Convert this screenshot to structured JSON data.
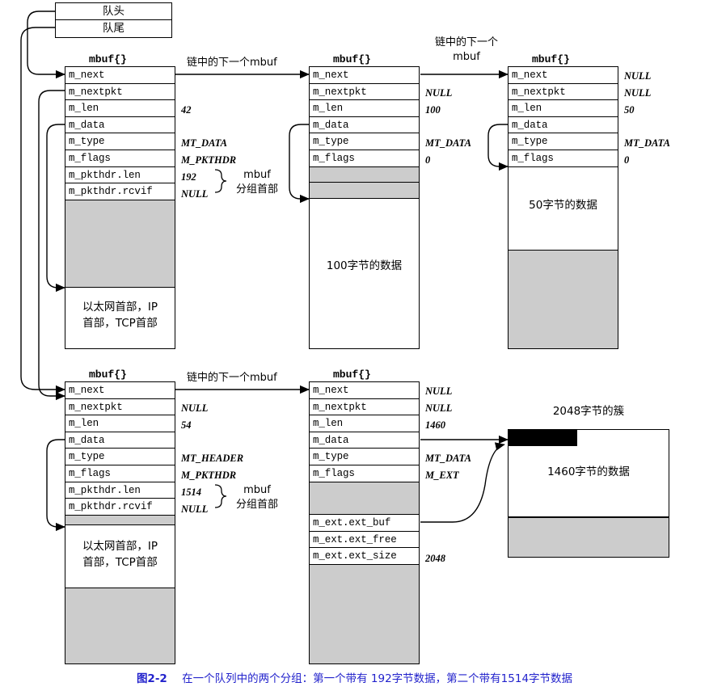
{
  "figure": {
    "number": "图2-2",
    "caption": "在一个队列中的两个分组：第一个带有 192字节数据，第二个带有1514字节数据"
  },
  "queue": {
    "head_label": "队头",
    "tail_label": "队尾"
  },
  "annotations": {
    "next_in_chain_mbuf": "链中的下一个mbuf",
    "next_in_chain_line1": "链中的下一个",
    "next_in_chain_line2": "mbuf",
    "mbuf_pkthdr_line1": "mbuf",
    "mbuf_pkthdr_line2": "分组首部",
    "cluster_2048": "2048字节的簇"
  },
  "struct_title": "mbuf{}",
  "field_names": {
    "m_next": "m_next",
    "m_nextpkt": "m_nextpkt",
    "m_len": "m_len",
    "m_data": "m_data",
    "m_type": "m_type",
    "m_flags": "m_flags",
    "m_pkthdr_len": "m_pkthdr.len",
    "m_pkthdr_rcvif": "m_pkthdr.rcvif",
    "m_ext_ext_buf": "m_ext.ext_buf",
    "m_ext_ext_free": "m_ext.ext_free",
    "m_ext_ext_size": "m_ext.ext_size"
  },
  "packet1": {
    "mbuf1": {
      "title": "mbuf{}",
      "m_next": "",
      "m_nextpkt": "",
      "m_len": "42",
      "m_data": "",
      "m_type": "MT_DATA",
      "m_flags": "M_PKTHDR",
      "m_pkthdr_len": "192",
      "m_pkthdr_rcvif": "NULL",
      "data_text": "以太网首部，IP\n首部，TCP首部",
      "data_text_line1": "以太网首部，IP",
      "data_text_line2": "首部，TCP首部"
    },
    "mbuf2": {
      "title": "mbuf{}",
      "m_next": "",
      "m_nextpkt": "NULL",
      "m_len": "100",
      "m_data": "",
      "m_type": "MT_DATA",
      "m_flags": "0",
      "data_text": "100字节的数据"
    },
    "mbuf3": {
      "title": "mbuf{}",
      "m_next": "NULL",
      "m_nextpkt": "NULL",
      "m_len": "50",
      "m_data": "",
      "m_type": "MT_DATA",
      "m_flags": "0",
      "data_text": "50字节的数据"
    }
  },
  "packet2": {
    "mbuf1": {
      "title": "mbuf{}",
      "m_next": "",
      "m_nextpkt": "NULL",
      "m_len": "54",
      "m_data": "",
      "m_type": "MT_HEADER",
      "m_flags": "M_PKTHDR",
      "m_pkthdr_len": "1514",
      "m_pkthdr_rcvif": "NULL",
      "data_text_line1": "以太网首部，IP",
      "data_text_line2": "首部，TCP首部"
    },
    "mbuf2": {
      "title": "mbuf{}",
      "m_next": "NULL",
      "m_nextpkt": "NULL",
      "m_len": "1460",
      "m_data": "",
      "m_type": "MT_DATA",
      "m_flags": "M_EXT",
      "m_ext_ext_buf": "",
      "m_ext_ext_free": "",
      "m_ext_ext_size": "2048"
    },
    "cluster": {
      "title": "2048字节的簇",
      "data_text": "1460字节的数据"
    }
  },
  "colors": {
    "gray_fill": "#cccccc",
    "caption_blue": "#2222cc",
    "stroke": "#000000",
    "cluster_bar": "#000000"
  }
}
